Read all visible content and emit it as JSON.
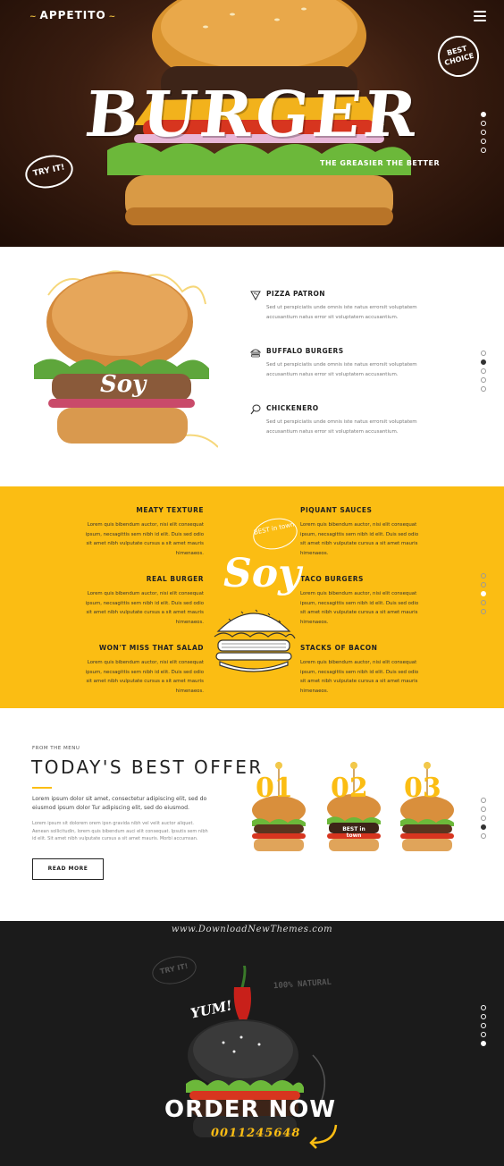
{
  "hero": {
    "logo": "APPETITO",
    "logo_dash": "~",
    "title": "BURGER",
    "tagline": "THE GREASIER THE BETTER",
    "badge_best": "BEST CHOICE",
    "badge_try": "TRY IT!"
  },
  "features": {
    "items": [
      {
        "title": "PIZZA PATRON",
        "icon": "pizza-icon",
        "text": "Sed ut perspiciatis unde omnis iste natus errorsit voluptatem accusantium natus error sit voluptatem accusantium."
      },
      {
        "title": "BUFFALO BURGERS",
        "icon": "burger-icon",
        "text": "Sed ut perspiciatis unde omnis iste natus errorsit voluptatem accusantium natus error sit voluptatem accusantium."
      },
      {
        "title": "CHICKENERO",
        "icon": "chicken-leg-icon",
        "text": "Sed ut perspiciatis unde omnis iste natus errorsit voluptatem accusantium natus error sit voluptatem accusantium."
      }
    ],
    "burger_label": "Soy"
  },
  "yellow": {
    "items": [
      {
        "title": "MEATY TEXTURE",
        "text": "Lorem quis bibendum auctor, nisi elit consequat ipsum, necsagittis sem nibh id elit. Duis sed odio sit amet nibh vulputate cursus a sit amet mauris himenaeos."
      },
      {
        "title": "PIQUANT SAUCES",
        "text": "Lorem quis bibendum auctor, nisi elit consequat ipsum, necsagittis sem nibh id elit. Duis sed odio sit amet nibh vulputate cursus a sit amet mauris himenaeos."
      },
      {
        "title": "REAL BURGER",
        "text": "Lorem quis bibendum auctor, nisi elit consequat ipsum, necsagittis sem nibh id elit. Duis sed odio sit amet nibh vulputate cursus a sit amet mauris himenaeos."
      },
      {
        "title": "TACO BURGERS",
        "text": "Lorem quis bibendum auctor, nisi elit consequat ipsum, necsagittis sem nibh id elit. Duis sed odio sit amet nibh vulputate cursus a sit amet mauris himenaeos."
      },
      {
        "title": "WON'T MISS THAT SALAD",
        "text": "Lorem quis bibendum auctor, nisi elit consequat ipsum, necsagittis sem nibh id elit. Duis sed odio sit amet nibh vulputate cursus a sit amet mauris himenaeos."
      },
      {
        "title": "STACKS OF BACON",
        "text": "Lorem quis bibendum auctor, nisi elit consequat ipsum, necsagittis sem nibh id elit. Duis sed odio sit amet nibh vulputate cursus a sit amet mauris himenaeos."
      }
    ],
    "center_label": "Soy",
    "badge": "BEST in town"
  },
  "offer": {
    "kicker": "FROM THE MENU",
    "heading": "TODAY'S BEST OFFER",
    "lead": "Lorem ipsum dolor sit amet, consectetur adipiscing elit, sed do eiusmod ipsum dolor Tur adipiscing elit, sed do eiusmod.",
    "body": "Lorem ipsum sit dolorem orem ipsn gravida nibh vel velit auctor aliquet. Aenean sollicitudin, lorem quis bibendum auci elit consequat. Ipsutis sem nibh id elit. Sit amet nibh vulputate cursus a sit amet mauris. Morbi accumsan.",
    "button": "READ MORE",
    "numbers": [
      "01",
      "02",
      "03"
    ],
    "badge": "BEST in town"
  },
  "order": {
    "watermark": "www.DownloadNewThemes.com",
    "yum": "YUM!",
    "natural": "100% NATURAL",
    "try": "TRY IT!",
    "cta": "ORDER NOW",
    "phone": "0011245648"
  },
  "colors": {
    "accent": "#fbbd13",
    "dark": "#1b1b1b",
    "hero_bg": "#3a1d10"
  },
  "pagination": {
    "hero_active": 0,
    "features_active": 1,
    "yellow_active": 2,
    "offer_active": 3,
    "order_active": 4
  }
}
